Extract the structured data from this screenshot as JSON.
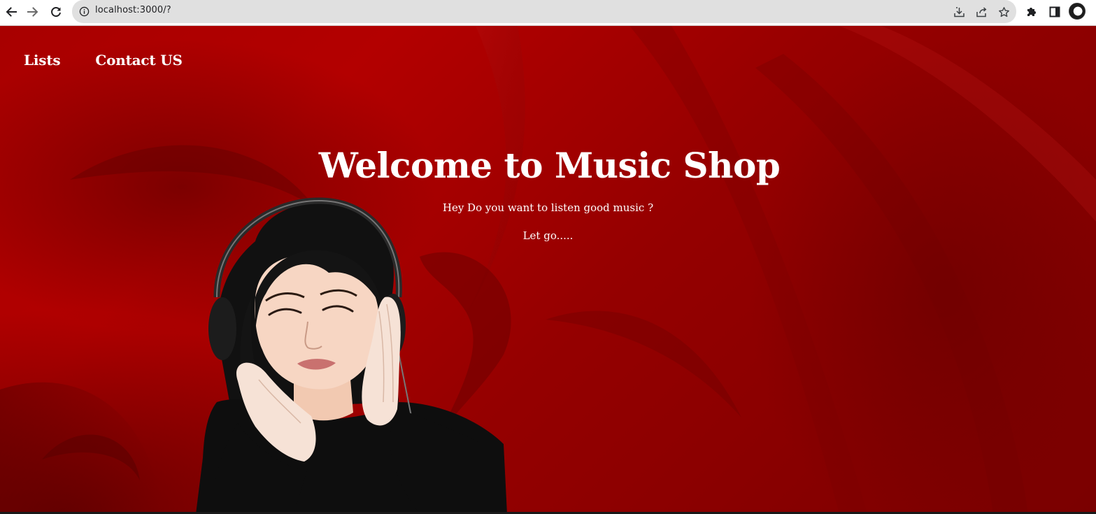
{
  "browser": {
    "url": "localhost:3000/?",
    "icons": {
      "back": "arrow-left-icon",
      "forward": "arrow-right-icon",
      "reload": "reload-icon",
      "site_info": "info-icon",
      "install": "install-icon",
      "share": "share-icon",
      "bookmark": "star-icon",
      "extensions": "puzzle-icon",
      "side_panel": "side-panel-icon",
      "profile": "avatar"
    }
  },
  "nav": {
    "items": [
      {
        "label": "Lists"
      },
      {
        "label": "Contact US"
      }
    ]
  },
  "hero": {
    "title": "Welcome to Music Shop",
    "subtitle": "Hey Do you want to listen good music ?",
    "tagline": "Let go....."
  },
  "colors": {
    "background": "#a00000",
    "text": "#ffffff",
    "chrome_bar": "#e0e0e0"
  }
}
